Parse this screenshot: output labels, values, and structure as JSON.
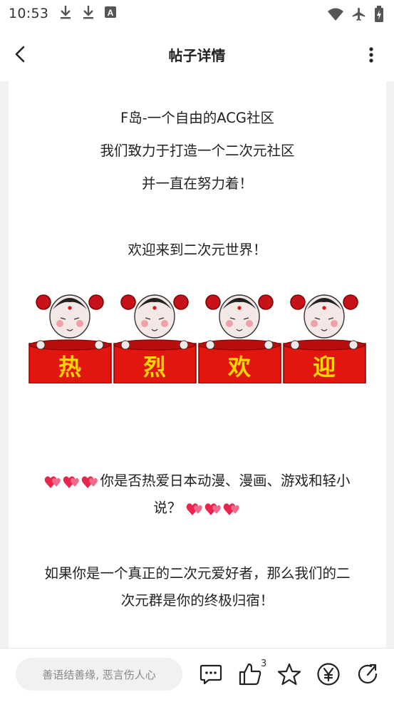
{
  "status_bar": {
    "time": "10:53",
    "icons": [
      "download-icon",
      "download-icon",
      "font-icon",
      "wifi-icon",
      "airplane-icon",
      "battery-icon"
    ]
  },
  "header": {
    "title": "帖子详情",
    "back_icon": "back-arrow-icon",
    "more_icon": "more-vertical-icon"
  },
  "post": {
    "line1": "F岛-一个自由的ACG社区",
    "line2": "我们致力于打造一个二次元社区",
    "line3": "并一直在努力着！",
    "line4": "欢迎来到二次元世界！",
    "banner_chars": [
      "热",
      "烈",
      "欢",
      "迎"
    ],
    "para1_a": "你是否热爱日本动漫、漫画、游戏和轻小",
    "para1_b": "说？",
    "para2_a": "如果你是一个真正的二次元爱好者，那么我们的二",
    "para2_b": "次元群是你的终极归宿！"
  },
  "bottom_bar": {
    "comment_placeholder": "善语结善缘, 恶言伤人心",
    "like_count": "3",
    "icons": [
      "comment-icon",
      "like-icon",
      "star-icon",
      "yen-icon",
      "share-icon"
    ]
  },
  "colors": {
    "banner_red": "#e0160f",
    "banner_text": "#ffd700",
    "heart_pink": "#e8254d"
  }
}
